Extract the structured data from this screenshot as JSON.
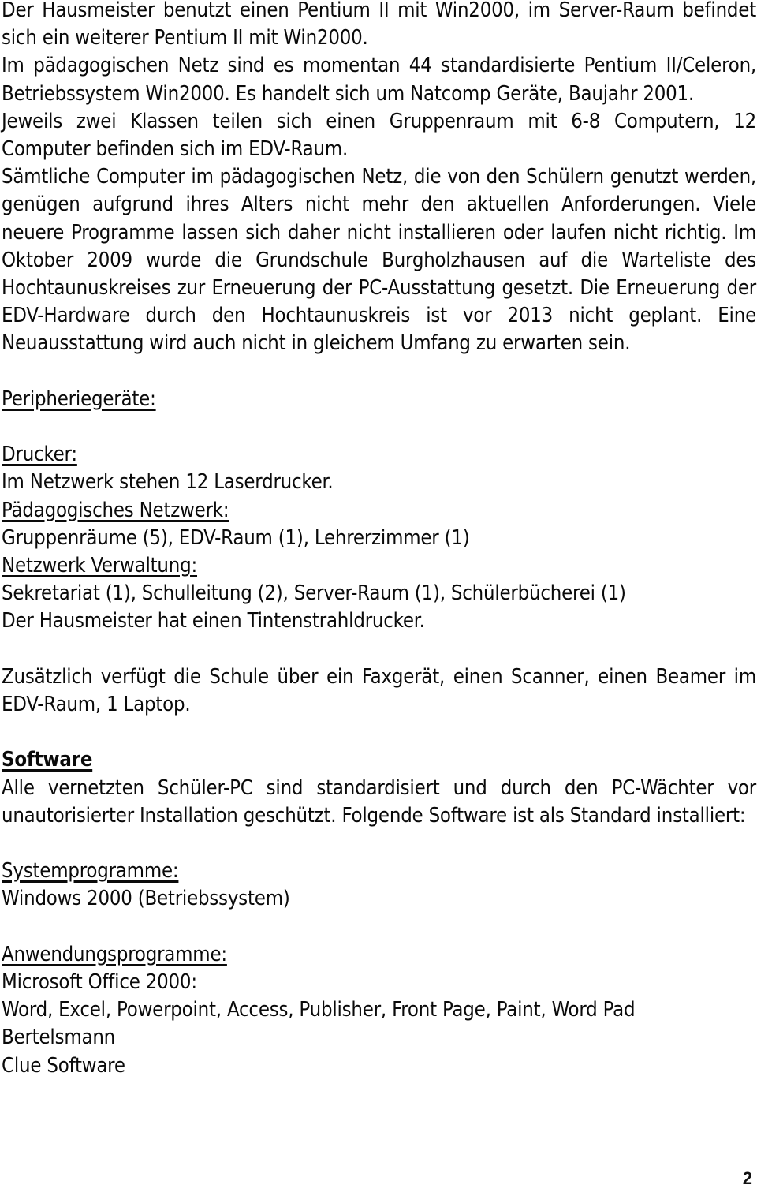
{
  "document": {
    "language": "de",
    "page_number": "2",
    "paragraphs": {
      "hausmeister": "Der Hausmeister benutzt einen Pentium II mit Win2000, im Server-Raum befindet sich ein weiterer Pentium II mit Win2000.",
      "paed_netz": "Im pädagogischen Netz sind es momentan 44 standardisierte Pentium II/Celeron, Betriebssystem Win2000. Es handelt sich um Natcomp Geräte, Baujahr 2001.",
      "klassen": "Jeweils zwei Klassen teilen sich einen Gruppenraum mit 6-8 Computern, 12 Computer befinden sich im EDV-Raum.",
      "saemtliche": "Sämtliche Computer im pädagogischen Netz, die von den Schülern genutzt werden, genügen aufgrund ihres Alters nicht mehr den aktuellen Anforderungen. Viele neuere Programme lassen sich daher nicht installieren oder laufen nicht richtig. Im Oktober 2009 wurde die Grundschule Burgholzhausen auf die Warteliste des Hochtaunuskreises zur Erneuerung der PC-Ausstattung gesetzt. Die Erneuerung der EDV-Hardware durch den Hochtaunuskreis ist vor 2013 nicht geplant. Eine Neuausstattung wird auch nicht in gleichem Umfang zu erwarten sein.",
      "zusaetzlich": "Zusätzlich verfügt die Schule über ein Faxgerät, einen Scanner, einen Beamer im EDV-Raum, 1 Laptop.",
      "software_intro": "Alle vernetzten Schüler-PC sind standardisiert und durch den PC-Wächter vor unautorisierter Installation geschützt. Folgende Software ist als Standard installiert:"
    },
    "headings": {
      "peripheriegeraete": "Peripheriegeräte:",
      "drucker": "Drucker:",
      "paedagogisches_netzwerk": "Pädagogisches Netzwerk:",
      "netzwerk_verwaltung": "Netzwerk Verwaltung:",
      "software": "Software",
      "systemprogramme": "Systemprogramme:",
      "anwendungsprogramme": "Anwendungsprogramme:"
    },
    "lines": {
      "drucker_text": "Im Netzwerk stehen 12 Laserdrucker.",
      "paed_netzwerk_raeume": "Gruppenräume (5), EDV-Raum (1), Lehrerzimmer (1)",
      "verwaltung_raeume": "Sekretariat (1), Schulleitung (2), Server-Raum (1), Schülerbücherei (1)",
      "hausmeister_drucker": "Der Hausmeister hat einen Tintenstrahldrucker.",
      "windows": "Windows 2000 (Betriebssystem)",
      "office_title": "Microsoft Office 2000:",
      "office_apps": "Word, Excel, Powerpoint, Access, Publisher, Front Page, Paint, Word Pad",
      "bertelsmann": "Bertelsmann",
      "clue_software": "Clue Software"
    }
  }
}
